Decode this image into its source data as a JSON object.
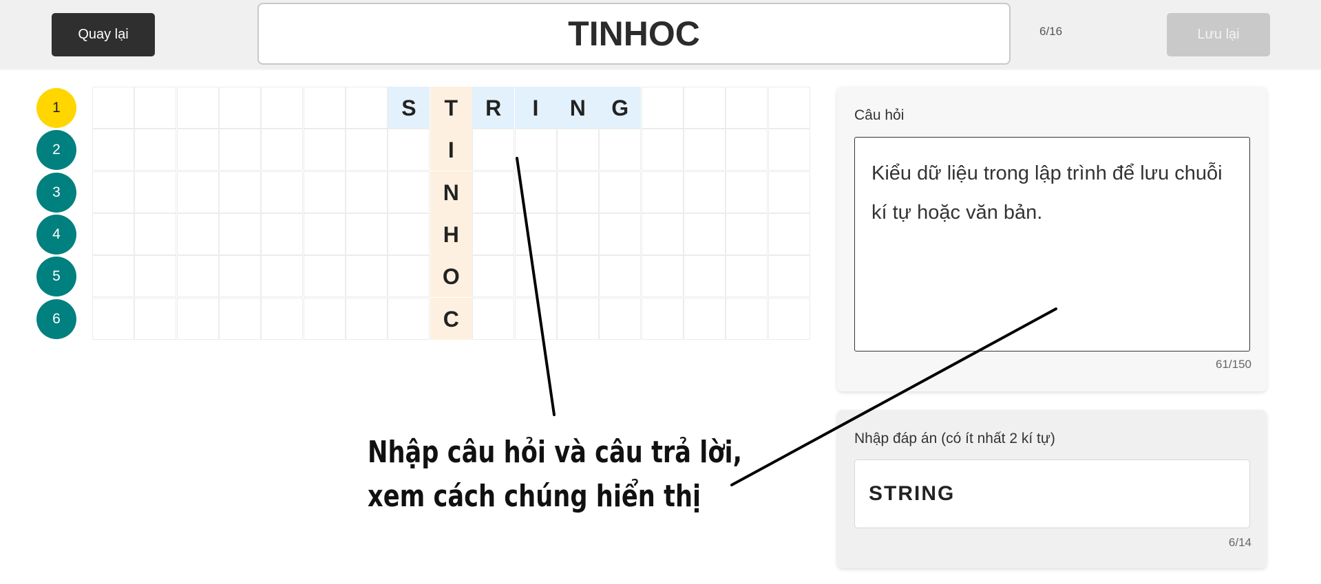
{
  "header": {
    "back_label": "Quay lại",
    "title": "TINHOC",
    "counter": "6/16",
    "save_label": "Lưu lại"
  },
  "rows": [
    {
      "number": "1",
      "color": "#ffd600",
      "text_color": "#222222",
      "active": true
    },
    {
      "number": "2",
      "color": "#00807f",
      "text_color": "#ffffff",
      "active": false
    },
    {
      "number": "3",
      "color": "#00807f",
      "text_color": "#ffffff",
      "active": false
    },
    {
      "number": "4",
      "color": "#00807f",
      "text_color": "#ffffff",
      "active": false
    },
    {
      "number": "5",
      "color": "#00807f",
      "text_color": "#ffffff",
      "active": false
    },
    {
      "number": "6",
      "color": "#00807f",
      "text_color": "#ffffff",
      "active": false
    }
  ],
  "grid": {
    "rows": 6,
    "cols": 17,
    "keyword_column": 8,
    "answer_row_1": "STRING",
    "answer_row_1_start_col": 7,
    "keyword_letters": [
      "T",
      "I",
      "N",
      "H",
      "O",
      "C"
    ],
    "colors": {
      "answer": "#e3f1fc",
      "keyword": "#fdf0e0"
    }
  },
  "question_panel": {
    "label": "Câu hỏi",
    "text": "Kiểu dữ liệu trong lập trình để lưu chuỗi kí tự hoặc văn bản.",
    "count": "61/150"
  },
  "answer_panel": {
    "label": "Nhập đáp án (có ít nhất 2 kí tự)",
    "value": "STRING",
    "count": "6/14"
  },
  "annotation": {
    "line1": "Nhập câu hỏi và câu trả lời,",
    "line2": "xem cách chúng hiển thị"
  }
}
